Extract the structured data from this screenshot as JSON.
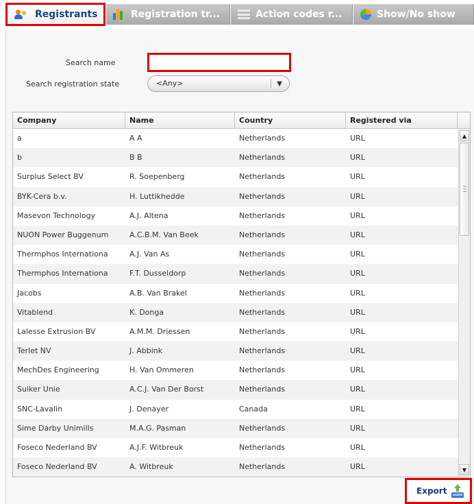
{
  "tabs": [
    {
      "label": "Registrants",
      "icon": "people-icon",
      "active": true
    },
    {
      "label": "Registration tr...",
      "icon": "bar-chart-icon",
      "active": false
    },
    {
      "label": "Action codes r...",
      "icon": "list-icon",
      "active": false
    },
    {
      "label": "Show/No show",
      "icon": "pie-chart-icon",
      "active": false
    }
  ],
  "search": {
    "name_label": "Search name",
    "name_value": "",
    "state_label": "Search registration state",
    "state_value": "<Any>"
  },
  "table": {
    "columns": [
      "Company",
      "Name",
      "Country",
      "Registered via"
    ],
    "rows": [
      [
        "a",
        "A A",
        "Netherlands",
        "URL"
      ],
      [
        "b",
        "B B",
        "Netherlands",
        "URL"
      ],
      [
        "Surplus Select BV",
        "R. Soepenberg",
        "Netherlands",
        "URL"
      ],
      [
        "BYK-Cera b.v.",
        "H. Luttikhedde",
        "Netherlands",
        "URL"
      ],
      [
        "Masevon Technology",
        "A.J. Altena",
        "Netherlands",
        "URL"
      ],
      [
        "NUON Power Buggenum",
        "A.C.B.M. Van Beek",
        "Netherlands",
        "URL"
      ],
      [
        "Thermphos Internationa",
        "A.J. Van As",
        "Netherlands",
        "URL"
      ],
      [
        "Thermphos Internationa",
        "F.T. Dusseldorp",
        "Netherlands",
        "URL"
      ],
      [
        "Jacobs",
        "A.B. Van Brakel",
        "Netherlands",
        "URL"
      ],
      [
        "Vitablend",
        "K. Donga",
        "Netherlands",
        "URL"
      ],
      [
        "Lalesse Extrusion BV",
        "A.M.M. Driessen",
        "Netherlands",
        "URL"
      ],
      [
        "Terlet NV",
        "J. Abbink",
        "Netherlands",
        "URL"
      ],
      [
        "MechDes Engineering",
        "H. Van Ommeren",
        "Netherlands",
        "URL"
      ],
      [
        "Suiker Unie",
        "A.C.J. Van Der Borst",
        "Netherlands",
        "URL"
      ],
      [
        "SNC-Lavalin",
        "J. Denayer",
        "Canada",
        "URL"
      ],
      [
        "Sime Darby Unimills",
        "M.A.G. Pasman",
        "Netherlands",
        "URL"
      ],
      [
        "Foseco Nederland BV",
        "A.J.F. Witbreuk",
        "Netherlands",
        "URL"
      ],
      [
        "Foseco Nederland BV",
        "A. Witbreuk",
        "Netherlands",
        "URL"
      ]
    ]
  },
  "export": {
    "label": "Export",
    "icon": "export-icon"
  },
  "colors": {
    "highlight": "#e00000",
    "accent_text": "#17467f"
  }
}
